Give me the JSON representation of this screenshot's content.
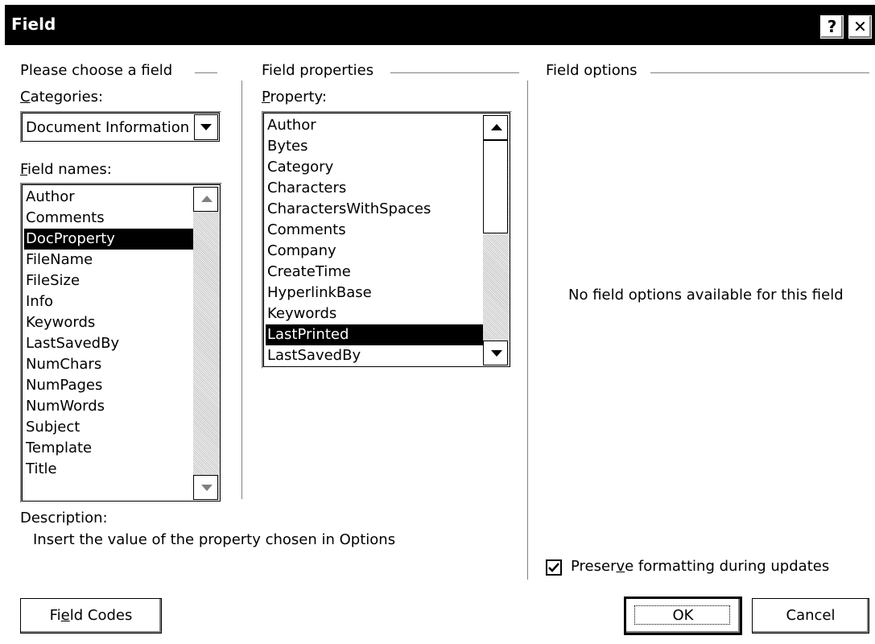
{
  "window": {
    "title": "Field",
    "help_glyph": "?",
    "close_glyph": "✕"
  },
  "groups": {
    "choose": "Please choose a field",
    "properties": "Field properties",
    "options": "Field options"
  },
  "categories": {
    "label_accel": "C",
    "label_rest": "ategories:",
    "selected": "Document Information"
  },
  "field_names": {
    "label_accel": "F",
    "label_rest": "ield names:",
    "items": [
      "Author",
      "Comments",
      "DocProperty",
      "FileName",
      "FileSize",
      "Info",
      "Keywords",
      "LastSavedBy",
      "NumChars",
      "NumPages",
      "NumWords",
      "Subject",
      "Template",
      "Title"
    ],
    "selected": "DocProperty"
  },
  "property": {
    "label_accel": "P",
    "label_rest": "roperty:",
    "items": [
      "Author",
      "Bytes",
      "Category",
      "Characters",
      "CharactersWithSpaces",
      "Comments",
      "Company",
      "CreateTime",
      "HyperlinkBase",
      "Keywords",
      "LastPrinted",
      "LastSavedBy"
    ],
    "selected": "LastPrinted"
  },
  "options_message": "No field options available for this field",
  "description": {
    "label": "Description:",
    "text": "Insert the value of the property chosen in Options"
  },
  "preserve": {
    "pre": "Preser",
    "accel": "v",
    "post": "e formatting during updates",
    "checked": true
  },
  "buttons": {
    "field_codes_pre": "Fi",
    "field_codes_accel": "e",
    "field_codes_post": "ld Codes",
    "ok": "OK",
    "cancel": "Cancel"
  }
}
